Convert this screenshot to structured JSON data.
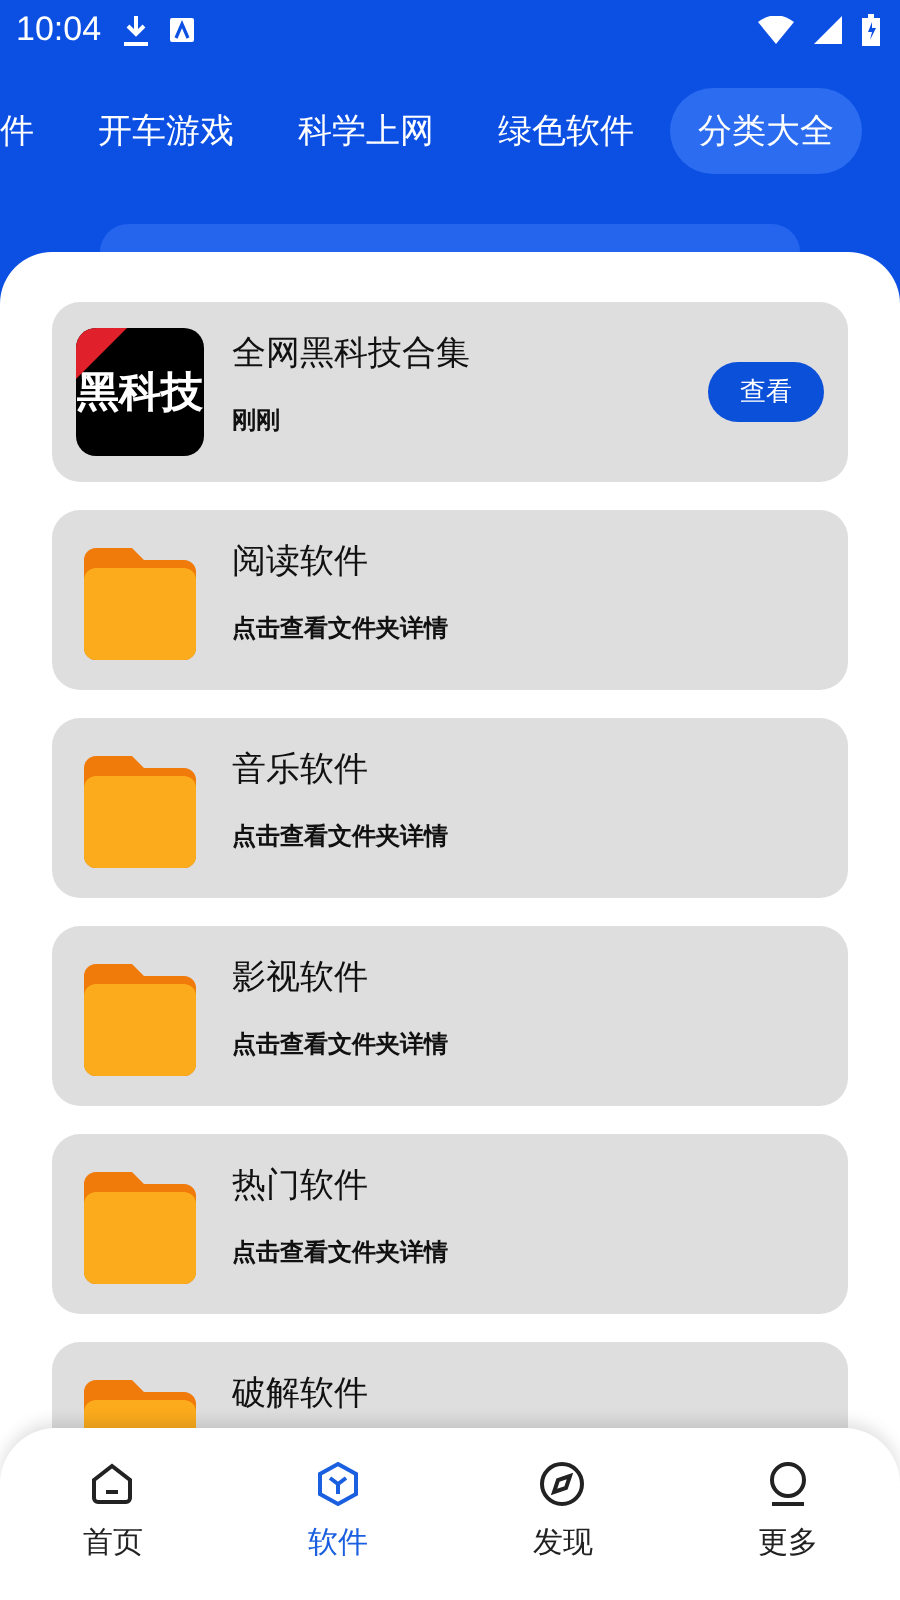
{
  "status_bar": {
    "time": "10:04"
  },
  "tabs": [
    {
      "label": "件",
      "selected": false
    },
    {
      "label": "开车游戏",
      "selected": false
    },
    {
      "label": "科学上网",
      "selected": false
    },
    {
      "label": "绿色软件",
      "selected": false
    },
    {
      "label": "分类大全",
      "selected": true
    }
  ],
  "items": [
    {
      "kind": "app",
      "icon_text": "黑科技",
      "title": "全网黑科技合集",
      "subtitle": "刚刚",
      "button": "查看"
    },
    {
      "kind": "folder",
      "title": "阅读软件",
      "subtitle": "点击查看文件夹详情"
    },
    {
      "kind": "folder",
      "title": "音乐软件",
      "subtitle": "点击查看文件夹详情"
    },
    {
      "kind": "folder",
      "title": "影视软件",
      "subtitle": "点击查看文件夹详情"
    },
    {
      "kind": "folder",
      "title": "热门软件",
      "subtitle": "点击查看文件夹详情"
    },
    {
      "kind": "folder",
      "title": "破解软件"
    }
  ],
  "nav": [
    {
      "kind": "home",
      "label": "首页",
      "selected": false
    },
    {
      "kind": "cube",
      "label": "软件",
      "selected": true
    },
    {
      "kind": "compass",
      "label": "发现",
      "selected": false
    },
    {
      "kind": "person",
      "label": "更多",
      "selected": false
    }
  ]
}
